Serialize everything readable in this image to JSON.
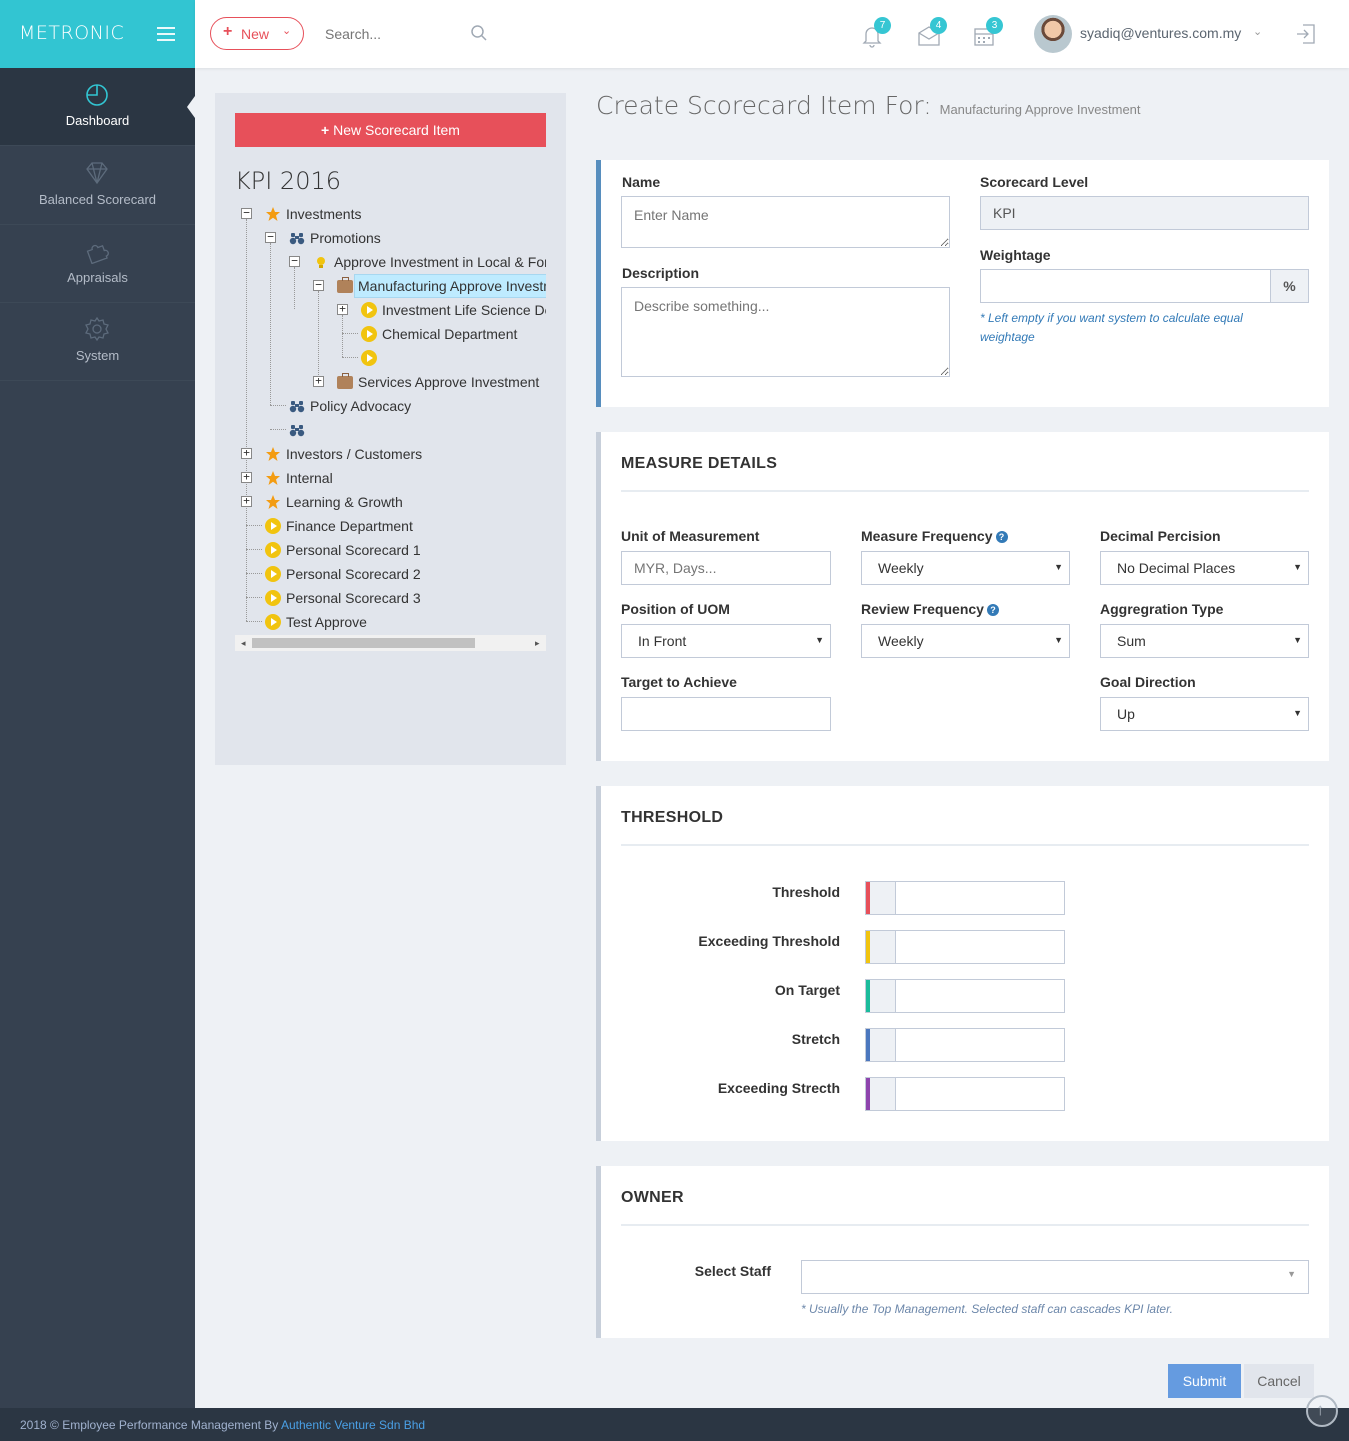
{
  "brand": {
    "logo": "METRONIC"
  },
  "header": {
    "new_label": "New",
    "search_placeholder": "Search...",
    "notifications_count": "7",
    "inbox_count": "4",
    "tasks_count": "3",
    "user_email": "syadiq@ventures.com.my"
  },
  "sidebar": {
    "items": [
      {
        "label": "Dashboard",
        "icon": "dashboard-icon",
        "active": true
      },
      {
        "label": "Balanced Scorecard",
        "icon": "diamond-icon"
      },
      {
        "label": "Appraisals",
        "icon": "puzzle-icon"
      },
      {
        "label": "System",
        "icon": "gear-icon"
      }
    ]
  },
  "tree_panel": {
    "new_item_label": "New Scorecard Item",
    "title": "KPI 2016",
    "nodes": [
      {
        "label": "Investments",
        "icon": "star-icon"
      },
      {
        "label": "Promotions",
        "icon": "binoculars-icon"
      },
      {
        "label": "Approve Investment in Local & Foreign Investment",
        "icon": "bulb-icon"
      },
      {
        "label": "Manufacturing Approve Investment",
        "icon": "briefcase-icon",
        "selected": true
      },
      {
        "label": "Investment Life Science Department",
        "icon": "play-icon"
      },
      {
        "label": "Chemical Department",
        "icon": "play-icon"
      },
      {
        "label": "",
        "icon": "play-icon"
      },
      {
        "label": "Services Approve Investment",
        "icon": "briefcase-icon"
      },
      {
        "label": "Policy Advocacy",
        "icon": "binoculars-icon"
      },
      {
        "label": "",
        "icon": "binoculars-icon"
      },
      {
        "label": "Investors / Customers",
        "icon": "star-icon"
      },
      {
        "label": "Internal",
        "icon": "star-icon"
      },
      {
        "label": "Learning & Growth",
        "icon": "star-icon"
      },
      {
        "label": "Finance Department",
        "icon": "play-icon"
      },
      {
        "label": "Personal Scorecard 1",
        "icon": "play-icon"
      },
      {
        "label": "Personal Scorecard 2",
        "icon": "play-icon"
      },
      {
        "label": "Personal Scorecard 3",
        "icon": "play-icon"
      },
      {
        "label": "Test Approve",
        "icon": "play-icon"
      }
    ]
  },
  "page": {
    "title": "Create Scorecard Item For:",
    "subtitle": "Manufacturing Approve Investment"
  },
  "general": {
    "name_label": "Name",
    "name_placeholder": "Enter Name",
    "description_label": "Description",
    "description_placeholder": "Describe something...",
    "level_label": "Scorecard Level",
    "level_value": "KPI",
    "weightage_label": "Weightage",
    "weightage_addon": "%",
    "weightage_help": "* Left empty if you want system to calculate equal weightage"
  },
  "measure": {
    "title": "MEASURE DETAILS",
    "uom_label": "Unit of Measurement",
    "uom_placeholder": "MYR, Days...",
    "measure_freq_label": "Measure Frequency",
    "measure_freq_value": "Weekly",
    "decimal_label": "Decimal Percision",
    "decimal_value": "No Decimal Places",
    "position_label": "Position of UOM",
    "position_value": "In Front",
    "review_freq_label": "Review Frequency",
    "review_freq_value": "Weekly",
    "aggregation_label": "Aggregration Type",
    "aggregation_value": "Sum",
    "target_label": "Target to Achieve",
    "goal_label": "Goal Direction",
    "goal_value": "Up"
  },
  "threshold": {
    "title": "THRESHOLD",
    "rows": [
      {
        "label": "Threshold",
        "color": "#e7505a"
      },
      {
        "label": "Exceeding Threshold",
        "color": "#f1c40f"
      },
      {
        "label": "On Target",
        "color": "#1bbc9b"
      },
      {
        "label": "Stretch",
        "color": "#4b77be"
      },
      {
        "label": "Exceeding Strecth",
        "color": "#8e44ad"
      }
    ]
  },
  "owner": {
    "title": "OWNER",
    "staff_label": "Select Staff",
    "staff_help": "* Usually the Top Management. Selected staff can cascades KPI later."
  },
  "actions": {
    "submit_label": "Submit",
    "cancel_label": "Cancel"
  },
  "footer": {
    "text": "2018 © Employee Performance Management By",
    "link": "Authentic Venture Sdn Bhd"
  }
}
